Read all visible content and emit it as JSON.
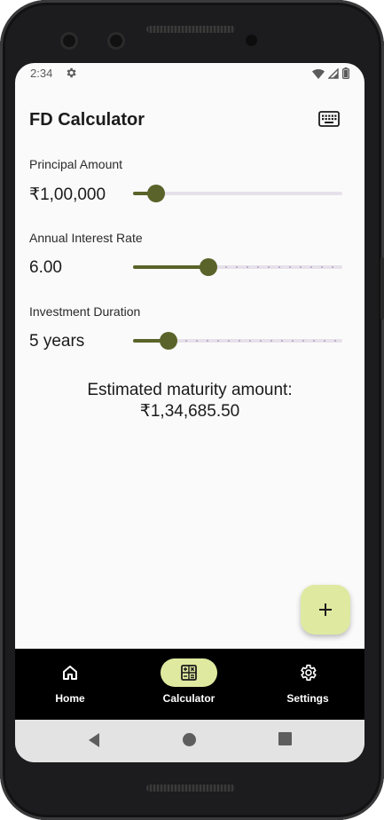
{
  "status_bar": {
    "time": "2:34",
    "icons": [
      "settings-icon",
      "wifi-icon",
      "signal-icon",
      "battery-icon"
    ]
  },
  "app_bar": {
    "title": "FD Calculator",
    "action_icon": "keyboard-icon"
  },
  "fields": {
    "principal": {
      "label": "Principal Amount",
      "value": "₹1,00,000",
      "slider_fraction": 0.11
    },
    "rate": {
      "label": "Annual Interest Rate",
      "value": "6.00",
      "slider_fraction": 0.36
    },
    "duration": {
      "label": "Investment Duration",
      "value": "5 years",
      "slider_fraction": 0.17
    }
  },
  "result": {
    "line1": "Estimated maturity amount:",
    "line2": "₹1,34,685.50"
  },
  "fab": {
    "icon": "plus-icon"
  },
  "bottom_nav": {
    "items": [
      {
        "label": "Home",
        "icon": "home-icon",
        "active": false
      },
      {
        "label": "Calculator",
        "icon": "calculator-icon",
        "active": true
      },
      {
        "label": "Settings",
        "icon": "settings-icon",
        "active": false
      }
    ]
  },
  "system_nav": {
    "icons": [
      "back-icon",
      "home-circle-icon",
      "recents-icon"
    ]
  },
  "colors": {
    "accent": "#5a6329",
    "accent_container": "#dfeaa0",
    "track_inactive": "#e6e0ea",
    "nav_background": "#000000",
    "screen_background": "#fafafa"
  }
}
